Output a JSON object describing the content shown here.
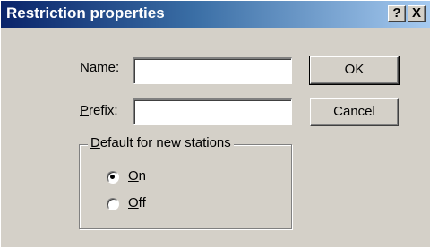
{
  "window": {
    "title": "Restriction properties",
    "help_symbol": "?",
    "close_symbol": "X"
  },
  "form": {
    "name": {
      "mnemonic": "N",
      "label_rest": "ame:",
      "value": ""
    },
    "prefix": {
      "mnemonic": "P",
      "label_rest": "refix:",
      "value": ""
    }
  },
  "buttons": {
    "ok": "OK",
    "cancel": "Cancel"
  },
  "group": {
    "mnemonic": "D",
    "title_rest": "efault for new stations",
    "options": [
      {
        "mnemonic": "O",
        "label_rest": "n",
        "selected": true
      },
      {
        "mnemonic": "O",
        "label_rest": "ff",
        "selected": false
      }
    ]
  }
}
